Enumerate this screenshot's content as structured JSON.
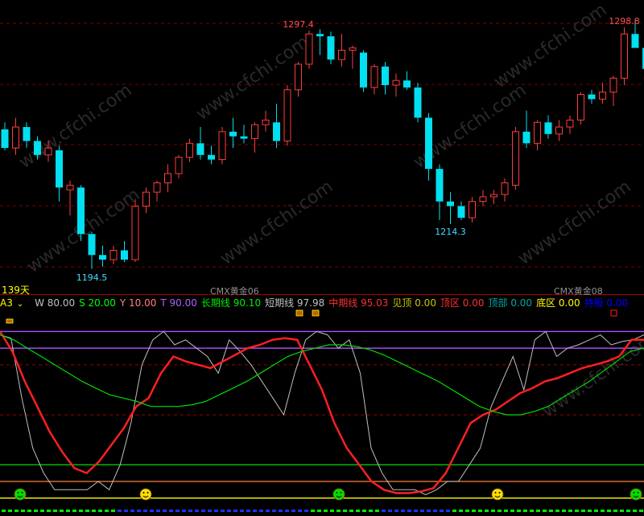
{
  "app": {
    "period_label": "139天",
    "contract_label_1": "CMX黄金06",
    "contract_label_2": "CMX黄金08",
    "watermark": "www.cfchi.com"
  },
  "indicator_bar": {
    "name": "A3",
    "items": [
      {
        "label": "W",
        "value": "80.00",
        "color": "#c0c0c0"
      },
      {
        "label": "S",
        "value": "20.00",
        "color": "#00ff00"
      },
      {
        "label": "Y",
        "value": "10.00",
        "color": "#ff8080"
      },
      {
        "label": "T",
        "value": "90.00",
        "color": "#b060ff"
      },
      {
        "label": "长期线",
        "value": "90.10",
        "color": "#00ee00"
      },
      {
        "label": "短期线",
        "value": "97.98",
        "color": "#c0c0c0"
      },
      {
        "label": "中期线",
        "value": "95.03",
        "color": "#ff3030"
      },
      {
        "label": "见顶",
        "value": "0.00",
        "color": "#c8c800"
      },
      {
        "label": "顶区",
        "value": "0.00",
        "color": "#ff3030"
      },
      {
        "label": "顶部",
        "value": "0.00",
        "color": "#00a8a8"
      },
      {
        "label": "底区",
        "value": "0.00",
        "color": "#ffff00"
      },
      {
        "label": "持股",
        "value": "0.00",
        "color": "#0000ff"
      }
    ]
  },
  "chart_data": [
    {
      "type": "candlestick",
      "title": "",
      "ylim": [
        1189,
        1303
      ],
      "annotations": [
        {
          "text": "1297.4",
          "index": 27,
          "y": 1297.4,
          "position": "above",
          "color": "#ff5050"
        },
        {
          "text": "1214.3",
          "index": 41,
          "y": 1214.3,
          "position": "below",
          "color": "#40e0ff"
        },
        {
          "text": "1194.5",
          "index": 8,
          "y": 1194.5,
          "position": "below",
          "color": "#40e0ff"
        },
        {
          "text": "1298.8",
          "index": 57,
          "y": 1298.8,
          "position": "above",
          "color": "#ff5050"
        }
      ],
      "candles": [
        [
          1255,
          1258,
          1246,
          1247
        ],
        [
          1247,
          1260,
          1244,
          1256
        ],
        [
          1256,
          1258,
          1247,
          1250
        ],
        [
          1250,
          1252,
          1242,
          1244
        ],
        [
          1244,
          1250,
          1241,
          1247
        ],
        [
          1246,
          1248,
          1224,
          1230
        ],
        [
          1229,
          1233,
          1218,
          1231
        ],
        [
          1230,
          1231,
          1207,
          1210
        ],
        [
          1210,
          1211,
          1195,
          1201
        ],
        [
          1201,
          1205,
          1196,
          1199
        ],
        [
          1199,
          1205,
          1197,
          1203
        ],
        [
          1203,
          1207,
          1198,
          1199
        ],
        [
          1199,
          1225,
          1198,
          1222
        ],
        [
          1222,
          1230,
          1219,
          1228
        ],
        [
          1228,
          1233,
          1224,
          1232
        ],
        [
          1232,
          1240,
          1228,
          1236
        ],
        [
          1236,
          1244,
          1234,
          1243
        ],
        [
          1243,
          1251,
          1241,
          1249
        ],
        [
          1249,
          1256,
          1242,
          1244
        ],
        [
          1244,
          1248,
          1240,
          1242
        ],
        [
          1242,
          1256,
          1240,
          1254
        ],
        [
          1254,
          1260,
          1247,
          1252
        ],
        [
          1252,
          1257,
          1249,
          1251
        ],
        [
          1251,
          1258,
          1245,
          1257
        ],
        [
          1257,
          1263,
          1254,
          1259
        ],
        [
          1258,
          1266,
          1247,
          1250
        ],
        [
          1250,
          1274,
          1248,
          1272
        ],
        [
          1272,
          1284,
          1269,
          1283
        ],
        [
          1283,
          1297.4,
          1281,
          1296
        ],
        [
          1296,
          1298,
          1287,
          1295
        ],
        [
          1295,
          1297,
          1283,
          1285
        ],
        [
          1285,
          1296,
          1282,
          1289
        ],
        [
          1289,
          1291,
          1281,
          1290
        ],
        [
          1288,
          1289,
          1271,
          1273
        ],
        [
          1273,
          1283,
          1270,
          1282
        ],
        [
          1282,
          1284,
          1270,
          1274
        ],
        [
          1274,
          1279,
          1269,
          1276
        ],
        [
          1276,
          1280,
          1272,
          1273
        ],
        [
          1273,
          1275,
          1258,
          1260
        ],
        [
          1260,
          1262,
          1233,
          1238
        ],
        [
          1238,
          1240,
          1216,
          1224
        ],
        [
          1224,
          1228,
          1214.3,
          1222
        ],
        [
          1222,
          1224,
          1216,
          1217
        ],
        [
          1217,
          1226,
          1215,
          1224
        ],
        [
          1224,
          1229,
          1222,
          1226
        ],
        [
          1226,
          1229,
          1223,
          1227
        ],
        [
          1227,
          1234,
          1224,
          1232
        ],
        [
          1231,
          1256,
          1229,
          1254
        ],
        [
          1254,
          1263,
          1247,
          1249
        ],
        [
          1249,
          1259,
          1246,
          1258
        ],
        [
          1258,
          1261,
          1251,
          1253
        ],
        [
          1253,
          1259,
          1250,
          1256
        ],
        [
          1256,
          1261,
          1253,
          1259
        ],
        [
          1259,
          1271,
          1257,
          1270
        ],
        [
          1270,
          1272,
          1266,
          1268
        ],
        [
          1268,
          1275,
          1266,
          1271
        ],
        [
          1271,
          1278,
          1265,
          1277
        ],
        [
          1277,
          1298.8,
          1274,
          1296
        ],
        [
          1296,
          1302,
          1292,
          1290
        ],
        [
          1290,
          1293,
          1279,
          1281
        ]
      ]
    },
    {
      "type": "line",
      "title": "",
      "ylim": [
        -4,
        106
      ],
      "series": [
        {
          "name": "短期线",
          "color": "#c0c0c0",
          "values": [
            98,
            96,
            60,
            30,
            15,
            5,
            5,
            5,
            5,
            10,
            5,
            20,
            45,
            80,
            95,
            100,
            92,
            95,
            90,
            85,
            75,
            95,
            88,
            80,
            70,
            60,
            50,
            75,
            95,
            100,
            98,
            90,
            95,
            75,
            30,
            15,
            5,
            5,
            5,
            2,
            5,
            10,
            10,
            20,
            30,
            55,
            70,
            85,
            65,
            95,
            100,
            85,
            90,
            92,
            95,
            98,
            92,
            94,
            95,
            97.98
          ]
        },
        {
          "name": "中期线",
          "color": "#ff2020",
          "values": [
            100,
            88,
            70,
            55,
            40,
            28,
            18,
            15,
            22,
            32,
            42,
            55,
            60,
            75,
            85,
            82,
            80,
            78,
            82,
            86,
            90,
            92,
            95,
            96,
            95,
            80,
            65,
            45,
            30,
            20,
            10,
            5,
            3,
            3,
            4,
            6,
            15,
            30,
            45,
            50,
            53,
            58,
            63,
            66,
            70,
            72,
            75,
            78,
            80,
            82,
            85,
            95,
            95.03
          ]
        },
        {
          "name": "长期线",
          "color": "#00dd00",
          "values": [
            98,
            95,
            90,
            85,
            80,
            75,
            70,
            66,
            62,
            60,
            58,
            55,
            55,
            55,
            56,
            58,
            62,
            66,
            70,
            75,
            80,
            85,
            88,
            90,
            92,
            92,
            91,
            89,
            86,
            82,
            78,
            74,
            70,
            65,
            60,
            55,
            52,
            50,
            50,
            52,
            55,
            60,
            65,
            70,
            76,
            82,
            88,
            90.1
          ]
        }
      ],
      "hlines": [
        {
          "y": 100,
          "color": "#b050ff"
        },
        {
          "y": 90,
          "color": "#b050ff"
        },
        {
          "y": 80,
          "color": "#a00000",
          "style": "dashed"
        },
        {
          "y": 50,
          "color": "#a00000",
          "style": "dashed"
        },
        {
          "y": 20,
          "color": "#00dd00"
        },
        {
          "y": 10,
          "color": "#ff8040"
        },
        {
          "y": 0,
          "color": "#ffff00"
        }
      ]
    }
  ]
}
